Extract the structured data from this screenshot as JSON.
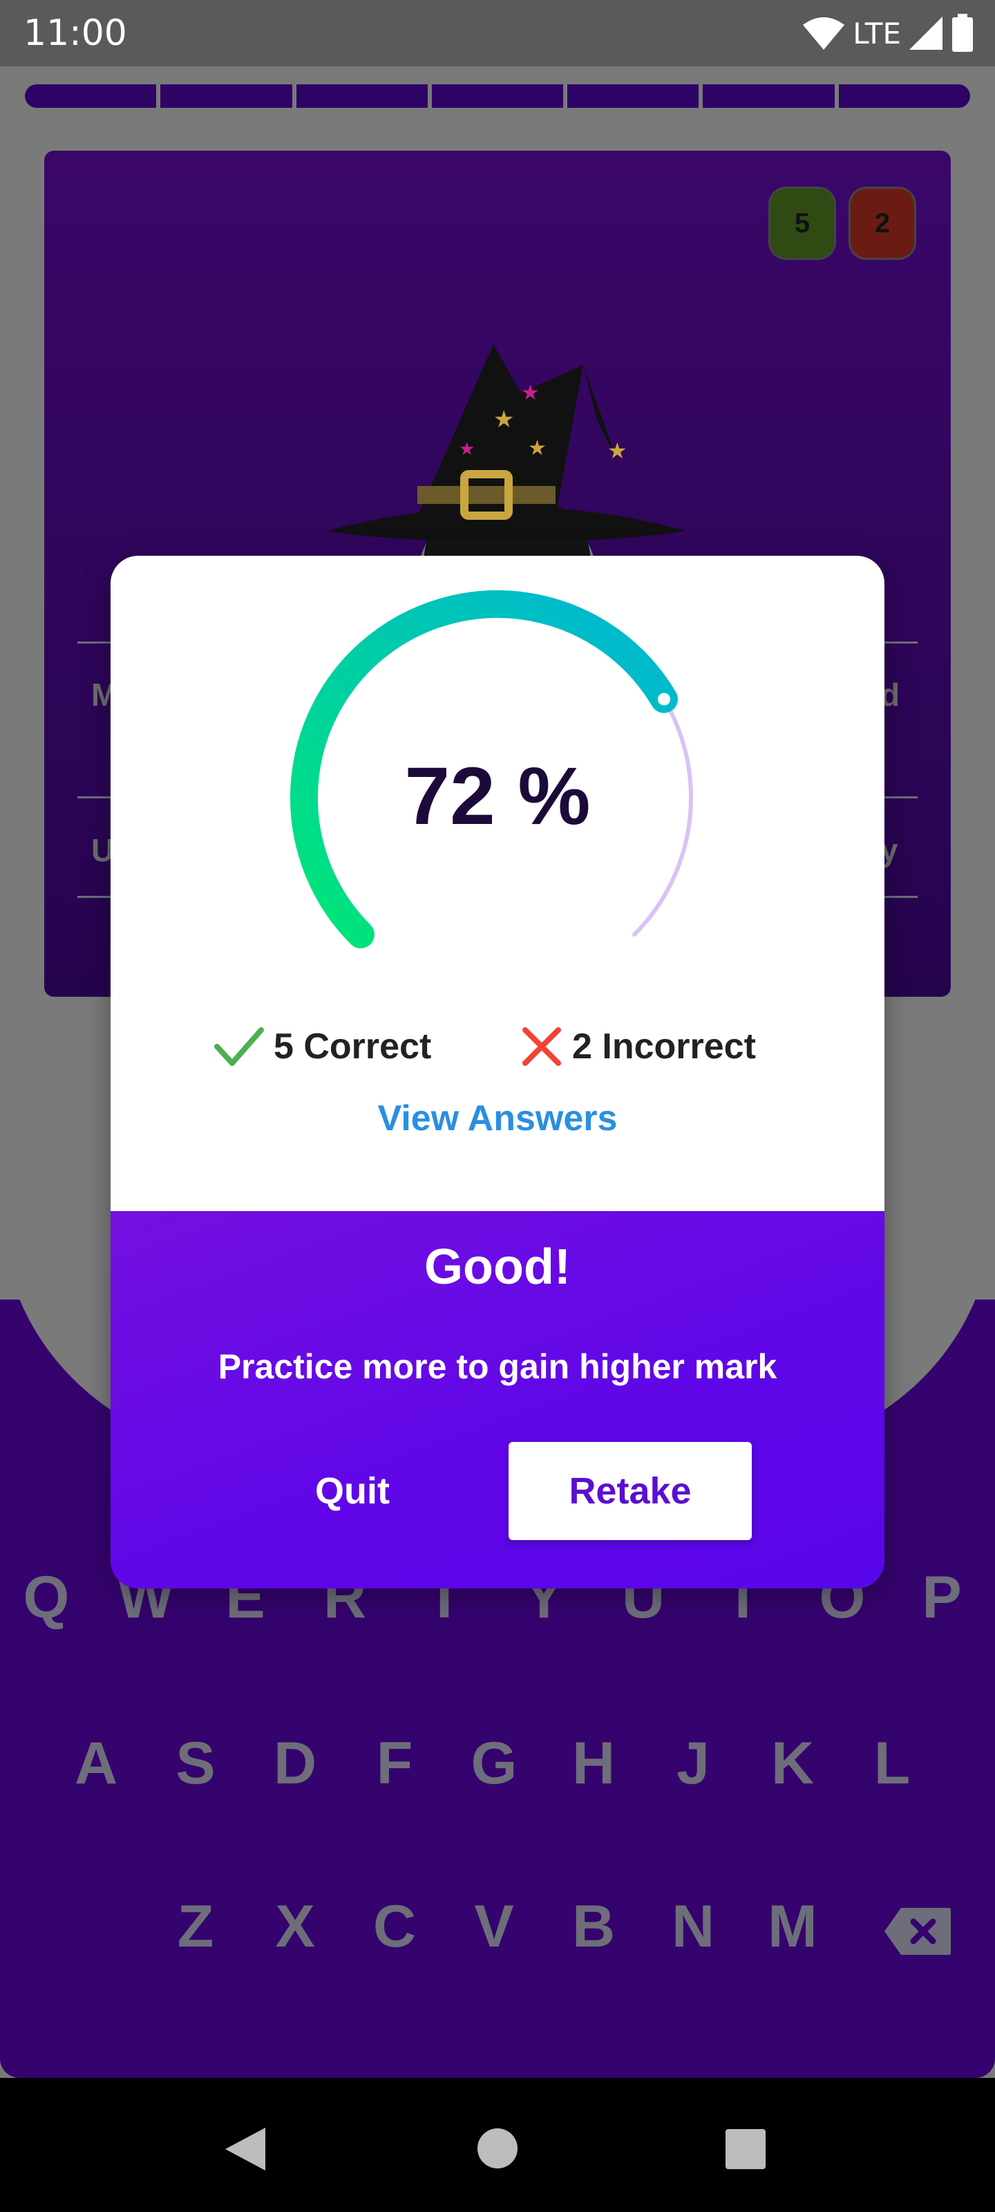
{
  "status_bar": {
    "time": "11:00",
    "network": "LTE"
  },
  "quiz": {
    "progress_segments": 7,
    "correct_count": "5",
    "wrong_count": "2",
    "colors": {
      "card": "#35036e",
      "correct_badge": "#2f4a13",
      "wrong_badge": "#6b1b14"
    },
    "fragments": {
      "row1_left": "M",
      "row1_right": "d",
      "row2_left": "U",
      "row2_right": "y"
    }
  },
  "keyboard": {
    "rows": [
      [
        "Q",
        "W",
        "E",
        "R",
        "T",
        "Y",
        "U",
        "I",
        "O",
        "P"
      ],
      [
        "A",
        "S",
        "D",
        "F",
        "G",
        "H",
        "J",
        "K",
        "L"
      ],
      [
        "Z",
        "X",
        "C",
        "V",
        "B",
        "N",
        "M"
      ]
    ]
  },
  "result_dialog": {
    "percentage": 0.72,
    "percent_label": "72 %",
    "correct_label": "5 Correct",
    "incorrect_label": "2 Incorrect",
    "view_answers_label": "View Answers",
    "verdict": "Good!",
    "advice": "Practice more to gain higher mark",
    "quit_label": "Quit",
    "retake_label": "Retake",
    "colors": {
      "gauge_start": "#00e676",
      "gauge_end": "#00b4d8",
      "gauge_track": "#d9c2f7",
      "accent": "#5f06e8",
      "link": "#2a8fe0"
    }
  }
}
